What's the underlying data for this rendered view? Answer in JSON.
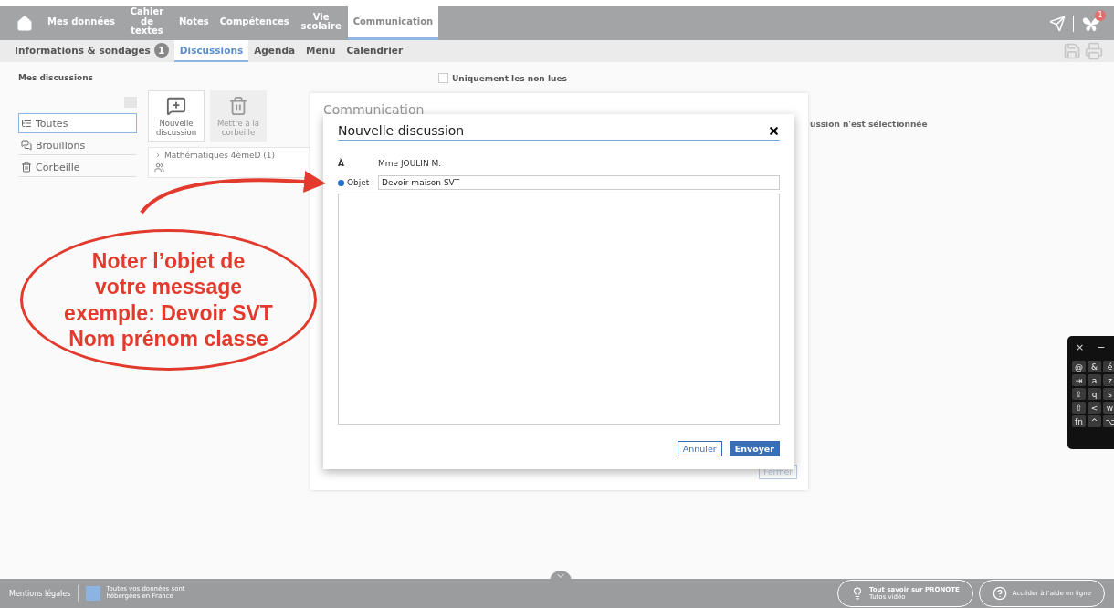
{
  "main_nav": [
    {
      "label": "Mes données",
      "selected": false
    },
    {
      "label": "Cahier de textes",
      "selected": false,
      "wrapped": true
    },
    {
      "label": "Notes",
      "selected": false
    },
    {
      "label": "Compétences",
      "selected": false
    },
    {
      "label": "Vie scolaire",
      "selected": false,
      "wrapped": true
    },
    {
      "label": "Communication",
      "selected": true
    }
  ],
  "notification_count": "1",
  "sub_nav": [
    {
      "label": "Informations & sondages",
      "badge": "1",
      "selected": false
    },
    {
      "label": "Discussions",
      "selected": true
    },
    {
      "label": "Agenda",
      "selected": false
    },
    {
      "label": "Menu",
      "selected": false
    },
    {
      "label": "Calendrier",
      "selected": false
    }
  ],
  "panel_title": "Mes discussions",
  "folders": [
    {
      "label": "Toutes",
      "kind": "all",
      "selected": true
    },
    {
      "label": "Brouillons",
      "kind": "drafts",
      "selected": false
    },
    {
      "label": "Corbeille",
      "kind": "trash",
      "selected": false
    }
  ],
  "toolbar": [
    {
      "label": "Nouvelle discussion",
      "kind": "new",
      "disabled": false
    },
    {
      "label": "Mettre à la corbeille",
      "kind": "trash",
      "disabled": true
    }
  ],
  "threads": [
    {
      "label": "Mathématiques 4èmeD (1)",
      "expanded": false
    }
  ],
  "unread_filter": {
    "label": "Uniquement les non lues",
    "checked": false
  },
  "empty_message": "ussion n'est sélectionnée",
  "outer_dialog": {
    "title": "Communication",
    "button": "Fermer"
  },
  "dialog": {
    "title": "Nouvelle discussion",
    "to_label": "À",
    "to_value": "Mme JOULIN M.",
    "subject_label": "Objet",
    "subject_value": "Devoir maison SVT",
    "cancel": "Annuler",
    "send": "Envoyer"
  },
  "callout": [
    "Noter l’objet de",
    "votre message",
    "exemple: Devoir SVT",
    "Nom prénom classe"
  ],
  "keyboard": {
    "close": "×",
    "minimize": "−",
    "rows": [
      [
        "@",
        "&",
        "é"
      ],
      [
        "⇥",
        "a",
        "z"
      ],
      [
        "⇪",
        "q",
        "s"
      ],
      [
        "⇧",
        "<",
        "w"
      ],
      [
        "fn",
        "^",
        "⌥"
      ]
    ]
  },
  "footer": {
    "legal": "Mentions légales",
    "hosting": "Toutes vos données sont hébergées en France",
    "tutorial_title": "Tout savoir sur PRONOTE",
    "tutorial_sub": "Tutos vidéo",
    "help": "Accéder à l'aide en ligne"
  }
}
